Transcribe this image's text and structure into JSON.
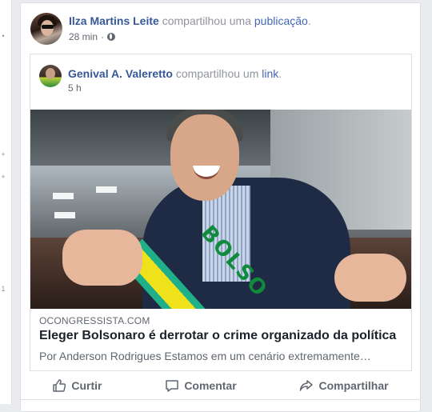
{
  "post": {
    "author": "Ilza Martins Leite",
    "action_text": "compartilhou uma",
    "action_link": "publicação",
    "action_end": ".",
    "time": "28 min",
    "time_sep": "·"
  },
  "shared_post": {
    "author": "Genival A. Valeretto",
    "action_text": "compartilhou um",
    "action_link": "link",
    "action_end": ".",
    "time": "5 h"
  },
  "link_preview": {
    "domain": "OCONGRESSISTA.COM",
    "headline": "Eleger Bolsonaro é derrotar o crime organizado da política",
    "excerpt": "Por Anderson Rodrigues Estamos em um cenário extremamente…",
    "sash_text": "BOLSO"
  },
  "actions": {
    "like": "Curtir",
    "comment": "Comentar",
    "share": "Compartilhar"
  },
  "sidebar": {
    "glyphs": [
      "•",
      "+",
      "+",
      "1"
    ]
  }
}
